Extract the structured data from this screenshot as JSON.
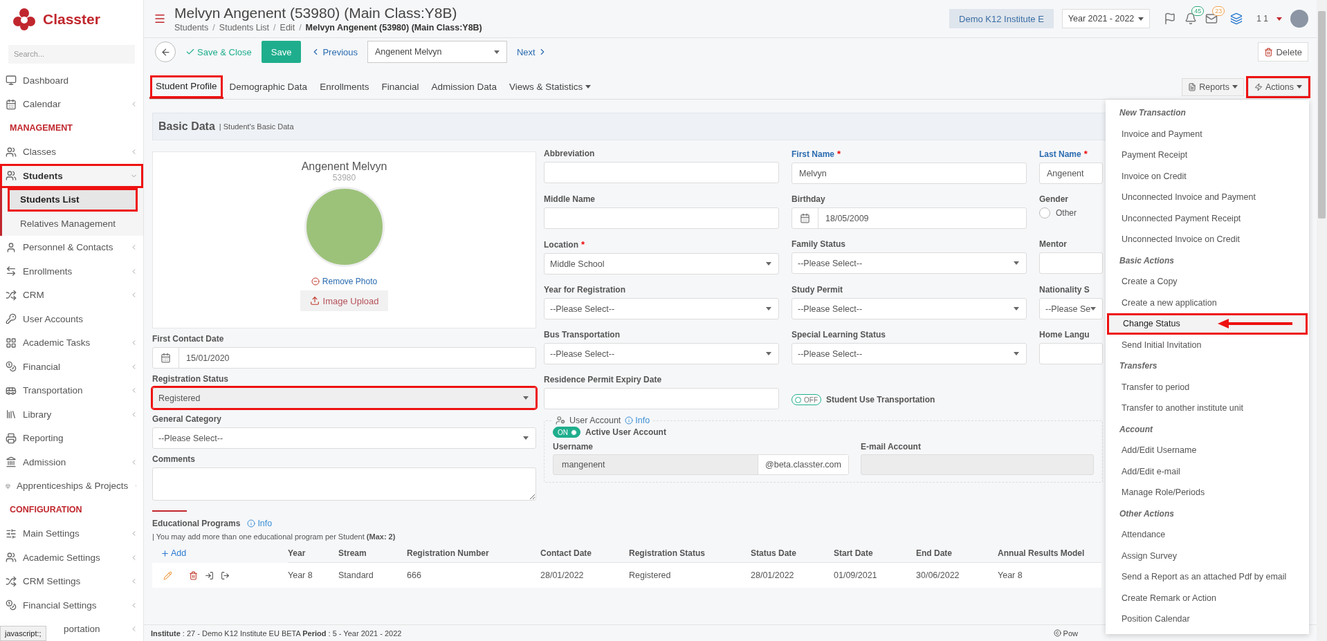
{
  "logo": {
    "text": "Classter"
  },
  "sidebar": {
    "search": {
      "placeholder": "Search..."
    },
    "items": [
      {
        "kind": "item",
        "label": "Dashboard",
        "submenu": false,
        "expanded": false,
        "highlighted": false,
        "covered": false
      },
      {
        "kind": "item",
        "label": "Calendar",
        "submenu": true,
        "expanded": false,
        "highlighted": false,
        "covered": false
      },
      {
        "kind": "header",
        "label": "MANAGEMENT"
      },
      {
        "kind": "item",
        "label": "Classes",
        "submenu": true,
        "expanded": false,
        "highlighted": false,
        "covered": false
      },
      {
        "kind": "item",
        "label": "Students",
        "submenu": true,
        "expanded": true,
        "highlighted": true,
        "covered": false,
        "children": [
          {
            "label": "Students List",
            "selected": true,
            "highlighted": true
          },
          {
            "label": "Relatives Management",
            "selected": false,
            "highlighted": false
          }
        ]
      },
      {
        "kind": "item",
        "label": "Personnel & Contacts",
        "submenu": true,
        "expanded": false,
        "highlighted": false,
        "covered": false
      },
      {
        "kind": "item",
        "label": "Enrollments",
        "submenu": true,
        "expanded": false,
        "highlighted": false,
        "covered": false
      },
      {
        "kind": "item",
        "label": "CRM",
        "submenu": true,
        "expanded": false,
        "highlighted": false,
        "covered": false
      },
      {
        "kind": "item",
        "label": "User Accounts",
        "submenu": false,
        "expanded": false,
        "highlighted": false,
        "covered": false
      },
      {
        "kind": "item",
        "label": "Academic Tasks",
        "submenu": true,
        "expanded": false,
        "highlighted": false,
        "covered": false
      },
      {
        "kind": "item",
        "label": "Financial",
        "submenu": true,
        "expanded": false,
        "highlighted": false,
        "covered": false
      },
      {
        "kind": "item",
        "label": "Transportation",
        "submenu": true,
        "expanded": false,
        "highlighted": false,
        "covered": false
      },
      {
        "kind": "item",
        "label": "Library",
        "submenu": true,
        "expanded": false,
        "highlighted": false,
        "covered": false
      },
      {
        "kind": "item",
        "label": "Reporting",
        "submenu": false,
        "expanded": false,
        "highlighted": false,
        "covered": false
      },
      {
        "kind": "item",
        "label": "Admission",
        "submenu": true,
        "expanded": false,
        "highlighted": false,
        "covered": false
      },
      {
        "kind": "item",
        "label": "Apprenticeships & Projects",
        "submenu": true,
        "expanded": false,
        "highlighted": false,
        "covered": false
      },
      {
        "kind": "header",
        "label": "CONFIGURATION"
      },
      {
        "kind": "item",
        "label": "Main Settings",
        "submenu": true,
        "expanded": false,
        "highlighted": false,
        "covered": false
      },
      {
        "kind": "item",
        "label": "Academic Settings",
        "submenu": true,
        "expanded": false,
        "highlighted": false,
        "covered": false
      },
      {
        "kind": "item",
        "label": "CRM Settings",
        "submenu": true,
        "expanded": false,
        "highlighted": false,
        "covered": false
      },
      {
        "kind": "item",
        "label": "Financial Settings",
        "submenu": true,
        "expanded": false,
        "highlighted": false,
        "covered": false
      },
      {
        "kind": "item",
        "label": "portation",
        "submenu": true,
        "expanded": false,
        "highlighted": false,
        "covered": true
      }
    ]
  },
  "browser_status": "javascript:;",
  "header": {
    "title": "Melvyn Angenent (53980) (Main Class:Y8B)",
    "breadcrumb": [
      "Students",
      "Students List",
      "Edit",
      "Melvyn Angenent (53980) (Main Class:Y8B)"
    ],
    "separator": "/",
    "institute": "Demo K12 Institute E",
    "year": "Year 2021 - 2022",
    "notifications": "45",
    "messages": "23",
    "user_label": "1 1"
  },
  "toolbar": {
    "save_close": "Save & Close",
    "save": "Save",
    "previous": "Previous",
    "record": "Angenent Melvyn",
    "next": "Next",
    "delete": "Delete"
  },
  "tabs": [
    {
      "label": "Student Profile",
      "selected": true,
      "highlighted": true,
      "dropdown": false
    },
    {
      "label": "Demographic Data",
      "selected": false,
      "highlighted": false,
      "dropdown": false
    },
    {
      "label": "Enrollments",
      "selected": false,
      "highlighted": false,
      "dropdown": false
    },
    {
      "label": "Financial",
      "selected": false,
      "highlighted": false,
      "dropdown": false
    },
    {
      "label": "Admission Data",
      "selected": false,
      "highlighted": false,
      "dropdown": false
    },
    {
      "label": "Views & Statistics",
      "selected": false,
      "highlighted": false,
      "dropdown": true
    }
  ],
  "reports": {
    "label": "Reports"
  },
  "actions": {
    "label": "Actions",
    "highlighted": true
  },
  "basic_data": {
    "title": "Basic Data",
    "subtitle": "| Student's Basic Data"
  },
  "profile": {
    "name": "Angenent Melvyn",
    "id": "53980",
    "remove_photo": "Remove Photo",
    "upload": "Image Upload"
  },
  "left_fields": [
    {
      "kind": "date",
      "label": "First Contact Date",
      "value": "15/01/2020",
      "highlighted": false,
      "disabled": false
    },
    {
      "kind": "select",
      "label": "Registration Status",
      "value": "Registered",
      "highlighted": true,
      "disabled": true
    },
    {
      "kind": "select",
      "label": "General Category",
      "value": "--Please Select--",
      "highlighted": false,
      "disabled": false
    },
    {
      "kind": "textarea",
      "label": "Comments",
      "highlighted": false,
      "disabled": false
    }
  ],
  "form_fields": [
    {
      "kind": "text",
      "label": "Abbreviation",
      "primary": false
    },
    {
      "kind": "text",
      "label": "First Name",
      "mark": "*",
      "value": "Melvyn",
      "primary": true
    },
    {
      "kind": "text",
      "label": "Last Name",
      "mark": "*",
      "value": "Angenent",
      "primary": true
    },
    {
      "kind": "text",
      "label": "Middle Name",
      "primary": false
    },
    {
      "kind": "date",
      "label": "Birthday",
      "value": "18/05/2009",
      "primary": false
    },
    {
      "kind": "radio",
      "label": "Gender",
      "option": "Other",
      "checked": false,
      "primary": false
    },
    {
      "kind": "select",
      "label": "Location",
      "mark": "*",
      "value": "Middle School",
      "primary": false
    },
    {
      "kind": "select",
      "label": "Family Status",
      "value": "--Please Select--",
      "primary": false
    },
    {
      "kind": "text",
      "label": "Mentor",
      "primary": false
    },
    {
      "kind": "select",
      "label": "Year for Registration",
      "value": "--Please Select--",
      "primary": false
    },
    {
      "kind": "select",
      "label": "Study Permit",
      "value": "--Please Select--",
      "primary": false
    },
    {
      "kind": "select",
      "label": "Nationality S",
      "value": "--Please Se",
      "primary": false
    },
    {
      "kind": "select",
      "label": "Bus Transportation",
      "value": "--Please Select--",
      "primary": false
    },
    {
      "kind": "select",
      "label": "Special Learning Status",
      "value": "--Please Select--",
      "primary": false
    },
    {
      "kind": "text",
      "label": "Home Langu",
      "primary": false
    },
    {
      "kind": "text",
      "label": "Residence Permit Expiry Date",
      "primary": false
    },
    {
      "kind": "toggle",
      "label": "Student Use Transportation",
      "caption": "OFF",
      "on": false
    }
  ],
  "user_account": {
    "title": "User Account",
    "info": "Info",
    "active_label": "Active User Account",
    "active_caption": "ON",
    "active_on": true,
    "username_label": "Username",
    "username": "mangenent",
    "domain": "@beta.classter.com",
    "email_label": "E-mail Account"
  },
  "educational": {
    "title": "Educational Programs",
    "info": "Info",
    "note": "| You may add more than one educational program per Student **(Max: 2)**",
    "add": "Add",
    "columns": [
      "Year",
      "Stream",
      "Registration Number",
      "Contact Date",
      "Registration Status",
      "Status Date",
      "Start Date",
      "End Date",
      "Annual Results Model"
    ],
    "rows": [
      [
        "Year 8",
        "Standard",
        "666",
        "28/01/2022",
        "Registered",
        "28/01/2022",
        "01/09/2021",
        "30/06/2022",
        "Year 8"
      ]
    ]
  },
  "footer": {
    "text": "**Institute** : 27 - Demo K12 Institute EU BETA **Period** : 5 - Year 2021 - 2022",
    "right": "Pow"
  },
  "actions_menu": [
    {
      "title": "New Transaction",
      "items": [
        {
          "label": "Invoice and Payment",
          "highlighted": false
        },
        {
          "label": "Payment Receipt",
          "highlighted": false
        },
        {
          "label": "Invoice on Credit",
          "highlighted": false
        },
        {
          "label": "Unconnected Invoice and Payment",
          "highlighted": false
        },
        {
          "label": "Unconnected Payment Receipt",
          "highlighted": false
        },
        {
          "label": "Unconnected Invoice on Credit",
          "highlighted": false
        }
      ]
    },
    {
      "title": "Basic Actions",
      "items": [
        {
          "label": "Create a Copy",
          "highlighted": false
        },
        {
          "label": "Create a new application",
          "highlighted": false
        },
        {
          "label": "Change Status",
          "highlighted": true
        },
        {
          "label": "Send Initial Invitation",
          "highlighted": false
        }
      ]
    },
    {
      "title": "Transfers",
      "items": [
        {
          "label": "Transfer to period",
          "highlighted": false
        },
        {
          "label": "Transfer to another institute unit",
          "highlighted": false
        }
      ]
    },
    {
      "title": "Account",
      "items": [
        {
          "label": "Add/Edit Username",
          "highlighted": false
        },
        {
          "label": "Add/Edit e-mail",
          "highlighted": false
        },
        {
          "label": "Manage Role/Periods",
          "highlighted": false
        }
      ]
    },
    {
      "title": "Other Actions",
      "items": [
        {
          "label": "Attendance",
          "highlighted": false
        },
        {
          "label": "Assign Survey",
          "highlighted": false
        },
        {
          "label": "Send a Report as an attached Pdf by email",
          "highlighted": false
        },
        {
          "label": "Create Remark or Action",
          "highlighted": false
        },
        {
          "label": "Position Calendar",
          "highlighted": false
        }
      ]
    }
  ]
}
